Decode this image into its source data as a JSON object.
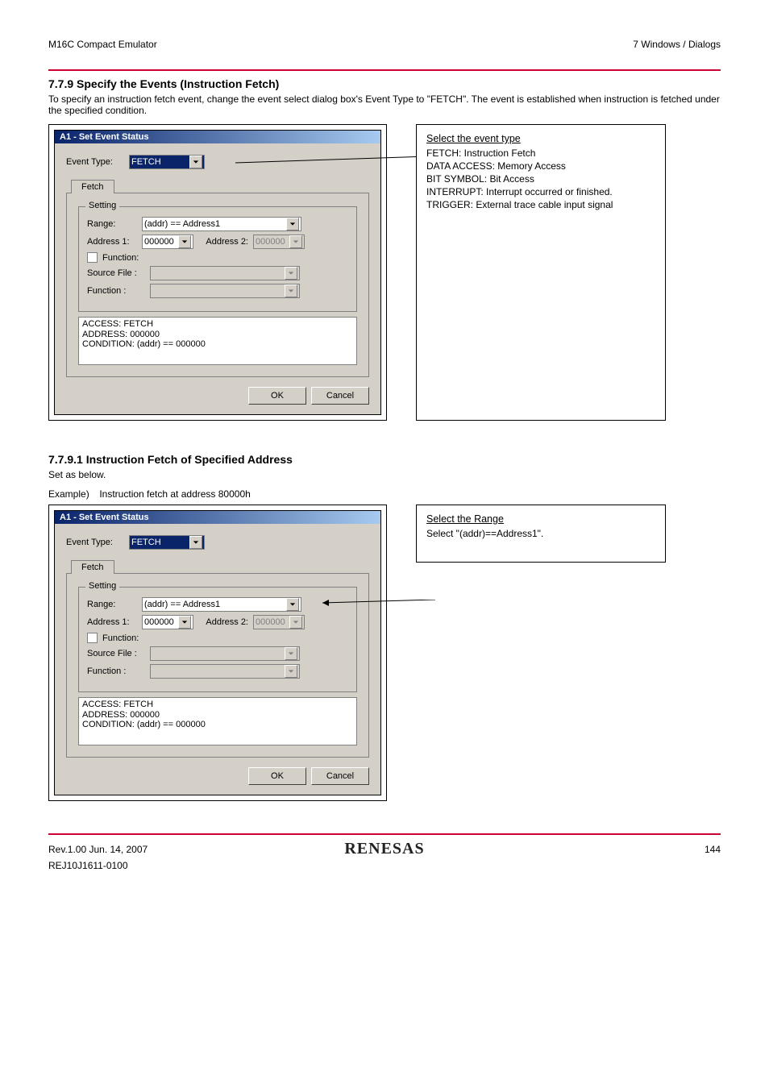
{
  "header": {
    "left": "M16C Compact Emulator",
    "right": "7 Windows / Dialogs"
  },
  "section1": {
    "heading": "7.7.9 Specify the Events (Instruction Fetch)",
    "sub": "To specify an instruction fetch event, change the event select dialog box's Event Type to \"FETCH\". The event is established when instruction is fetched under the specified condition."
  },
  "dialog": {
    "title": "A1 - Set Event Status",
    "eventTypeLabel": "Event Type:",
    "eventTypeValue": "FETCH",
    "tabLabel": "Fetch",
    "groupTitle": "Setting",
    "rangeLabel": "Range:",
    "rangeValue": "(addr) == Address1",
    "addr1Label": "Address 1:",
    "addr1Value": "000000",
    "addr2Label": "Address 2:",
    "addr2Value": "000000",
    "functionChk": "Function:",
    "srcLabel": "Source File :",
    "funcLabel": "Function :",
    "status": {
      "l1": "ACCESS: FETCH",
      "l2": "ADDRESS: 000000",
      "l3": "CONDITION: (addr) == 000000"
    },
    "ok": "OK",
    "cancel": "Cancel"
  },
  "callout1": {
    "title": "Select the event type",
    "lines": [
      "FETCH:      Instruction Fetch",
      "DATA ACCESS:  Memory Access",
      "BIT SYMBOL:  Bit Access",
      "INTERRUPT:  Interrupt occurred or finished.",
      "TRIGGER:  External trace cable input signal"
    ]
  },
  "section2": {
    "heading": "7.7.9.1 Instruction Fetch of Specified Address",
    "sub": "Set as below."
  },
  "example": {
    "label": "Example)",
    "text": "Instruction fetch at address 80000h"
  },
  "callout2": {
    "title": "Select the Range",
    "lines": [
      "Select \"(addr)==Address1\"."
    ]
  },
  "footer": {
    "rev": "Rev.1.00 Jun. 14, 2007",
    "page": "144",
    "logo": "RENESAS",
    "code": "REJ10J1611-0100"
  }
}
